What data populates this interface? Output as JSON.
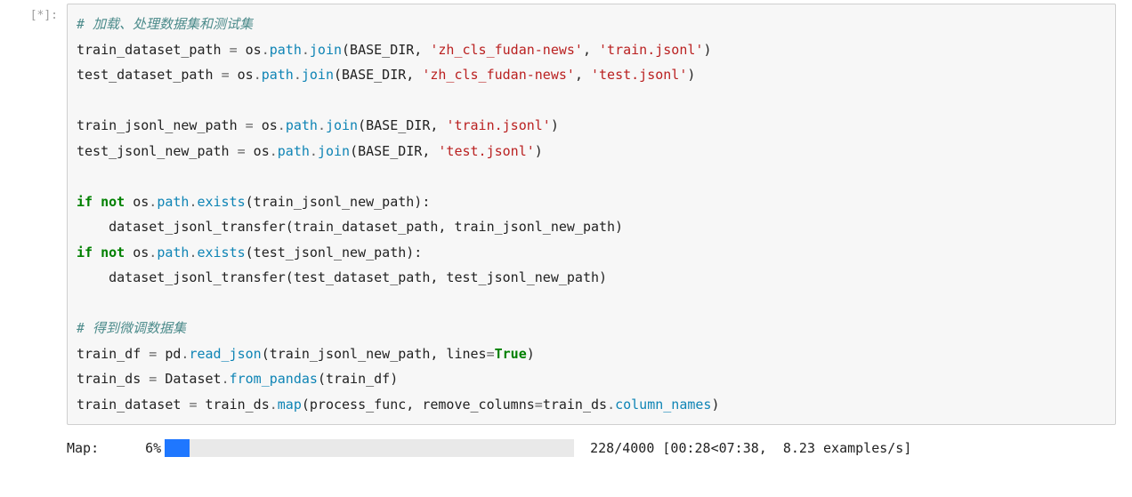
{
  "cell": {
    "prompt": "[*]:",
    "code_tokens": [
      [
        {
          "t": "# 加载、处理数据集和测试集",
          "c": "tok-c1"
        }
      ],
      [
        {
          "t": "train_dataset_path ",
          "c": ""
        },
        {
          "t": "=",
          "c": "tok-o"
        },
        {
          "t": " os",
          "c": ""
        },
        {
          "t": ".",
          "c": "tok-o"
        },
        {
          "t": "path",
          "c": "tok-nn"
        },
        {
          "t": ".",
          "c": "tok-o"
        },
        {
          "t": "join",
          "c": "tok-nn"
        },
        {
          "t": "(BASE_DIR, ",
          "c": ""
        },
        {
          "t": "'zh_cls_fudan-news'",
          "c": "tok-s1"
        },
        {
          "t": ", ",
          "c": ""
        },
        {
          "t": "'train.jsonl'",
          "c": "tok-s1"
        },
        {
          "t": ")",
          "c": ""
        }
      ],
      [
        {
          "t": "test_dataset_path ",
          "c": ""
        },
        {
          "t": "=",
          "c": "tok-o"
        },
        {
          "t": " os",
          "c": ""
        },
        {
          "t": ".",
          "c": "tok-o"
        },
        {
          "t": "path",
          "c": "tok-nn"
        },
        {
          "t": ".",
          "c": "tok-o"
        },
        {
          "t": "join",
          "c": "tok-nn"
        },
        {
          "t": "(BASE_DIR, ",
          "c": ""
        },
        {
          "t": "'zh_cls_fudan-news'",
          "c": "tok-s1"
        },
        {
          "t": ", ",
          "c": ""
        },
        {
          "t": "'test.jsonl'",
          "c": "tok-s1"
        },
        {
          "t": ")",
          "c": ""
        }
      ],
      [],
      [
        {
          "t": "train_jsonl_new_path ",
          "c": ""
        },
        {
          "t": "=",
          "c": "tok-o"
        },
        {
          "t": " os",
          "c": ""
        },
        {
          "t": ".",
          "c": "tok-o"
        },
        {
          "t": "path",
          "c": "tok-nn"
        },
        {
          "t": ".",
          "c": "tok-o"
        },
        {
          "t": "join",
          "c": "tok-nn"
        },
        {
          "t": "(BASE_DIR, ",
          "c": ""
        },
        {
          "t": "'train.jsonl'",
          "c": "tok-s1"
        },
        {
          "t": ")",
          "c": ""
        }
      ],
      [
        {
          "t": "test_jsonl_new_path ",
          "c": ""
        },
        {
          "t": "=",
          "c": "tok-o"
        },
        {
          "t": " os",
          "c": ""
        },
        {
          "t": ".",
          "c": "tok-o"
        },
        {
          "t": "path",
          "c": "tok-nn"
        },
        {
          "t": ".",
          "c": "tok-o"
        },
        {
          "t": "join",
          "c": "tok-nn"
        },
        {
          "t": "(BASE_DIR, ",
          "c": ""
        },
        {
          "t": "'test.jsonl'",
          "c": "tok-s1"
        },
        {
          "t": ")",
          "c": ""
        }
      ],
      [],
      [
        {
          "t": "if",
          "c": "tok-k"
        },
        {
          "t": " ",
          "c": ""
        },
        {
          "t": "not",
          "c": "tok-k"
        },
        {
          "t": " os",
          "c": ""
        },
        {
          "t": ".",
          "c": "tok-o"
        },
        {
          "t": "path",
          "c": "tok-nn"
        },
        {
          "t": ".",
          "c": "tok-o"
        },
        {
          "t": "exists",
          "c": "tok-nn"
        },
        {
          "t": "(train_jsonl_new_path):",
          "c": ""
        }
      ],
      [
        {
          "t": "    dataset_jsonl_transfer(train_dataset_path, train_jsonl_new_path)",
          "c": ""
        }
      ],
      [
        {
          "t": "if",
          "c": "tok-k"
        },
        {
          "t": " ",
          "c": ""
        },
        {
          "t": "not",
          "c": "tok-k"
        },
        {
          "t": " os",
          "c": ""
        },
        {
          "t": ".",
          "c": "tok-o"
        },
        {
          "t": "path",
          "c": "tok-nn"
        },
        {
          "t": ".",
          "c": "tok-o"
        },
        {
          "t": "exists",
          "c": "tok-nn"
        },
        {
          "t": "(test_jsonl_new_path):",
          "c": ""
        }
      ],
      [
        {
          "t": "    dataset_jsonl_transfer(test_dataset_path, test_jsonl_new_path)",
          "c": ""
        }
      ],
      [],
      [
        {
          "t": "# 得到微调数据集",
          "c": "tok-c1"
        }
      ],
      [
        {
          "t": "train_df ",
          "c": ""
        },
        {
          "t": "=",
          "c": "tok-o"
        },
        {
          "t": " pd",
          "c": ""
        },
        {
          "t": ".",
          "c": "tok-o"
        },
        {
          "t": "read_json",
          "c": "tok-nn"
        },
        {
          "t": "(train_jsonl_new_path, lines",
          "c": ""
        },
        {
          "t": "=",
          "c": "tok-o"
        },
        {
          "t": "True",
          "c": "tok-kc"
        },
        {
          "t": ")",
          "c": ""
        }
      ],
      [
        {
          "t": "train_ds ",
          "c": ""
        },
        {
          "t": "=",
          "c": "tok-o"
        },
        {
          "t": " Dataset",
          "c": ""
        },
        {
          "t": ".",
          "c": "tok-o"
        },
        {
          "t": "from_pandas",
          "c": "tok-nn"
        },
        {
          "t": "(train_df)",
          "c": ""
        }
      ],
      [
        {
          "t": "train_dataset ",
          "c": ""
        },
        {
          "t": "=",
          "c": "tok-o"
        },
        {
          "t": " train_ds",
          "c": ""
        },
        {
          "t": ".",
          "c": "tok-o"
        },
        {
          "t": "map",
          "c": "tok-nn"
        },
        {
          "t": "(process_func, remove_columns",
          "c": ""
        },
        {
          "t": "=",
          "c": "tok-o"
        },
        {
          "t": "train_ds",
          "c": ""
        },
        {
          "t": ".",
          "c": "tok-o"
        },
        {
          "t": "column_names",
          "c": "tok-nn"
        },
        {
          "t": ")",
          "c": ""
        }
      ]
    ]
  },
  "output": {
    "label": "Map:",
    "percent": "6%",
    "fill_pct": 6,
    "stats": "228/4000 [00:28<07:38,  8.23 examples/s]"
  }
}
